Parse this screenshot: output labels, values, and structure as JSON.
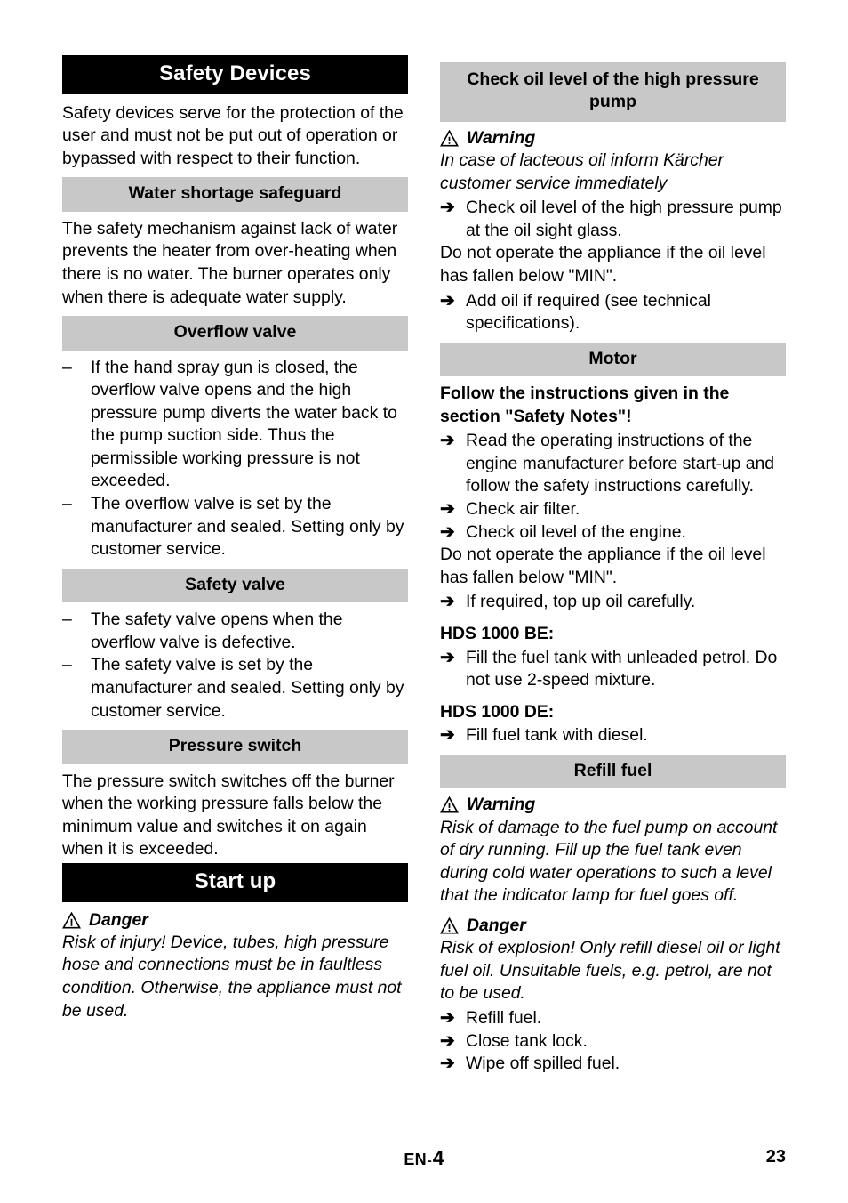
{
  "document": {
    "language_marker": "EN",
    "section_number": "4",
    "page_number": "23",
    "footer_separator": "-"
  },
  "icons": {
    "warning_triangle": "warning-triangle-icon",
    "arrow_bullet": "➔",
    "dash_bullet": "–"
  },
  "colors": {
    "heading_black_bg": "#000000",
    "heading_black_fg": "#ffffff",
    "heading_gray_bg": "#c8c8c8",
    "text": "#000000",
    "page_bg": "#ffffff"
  },
  "left_column": {
    "main_heading": "Safety Devices",
    "intro": "Safety devices serve for the protection of the user and must not be put out of operation or bypassed with respect to their function.",
    "water_shortage": {
      "heading": "Water shortage safeguard",
      "text": "The safety mechanism against lack of water prevents the heater from over-heating when there is no water. The burner operates only when there is adequate water supply."
    },
    "overflow_valve": {
      "heading": "Overflow valve",
      "items": [
        "If the hand spray gun is closed, the overflow valve opens and the high pressure pump diverts the water back to the pump suction side.  Thus the permissible working pressure is not exceeded.",
        "The overflow valve is set by the manufacturer and sealed. Setting only by customer service."
      ]
    },
    "safety_valve": {
      "heading": "Safety valve",
      "items": [
        "The safety valve opens when the overflow valve is defective.",
        "The safety valve is set by the manufacturer and sealed. Setting only by customer service."
      ]
    },
    "pressure_switch": {
      "heading": "Pressure switch",
      "text": "The pressure switch switches off the burner when the working pressure falls below the minimum value and switches it on again when it is exceeded."
    },
    "start_up": {
      "heading": "Start up",
      "danger_label": "Danger",
      "danger_text": "Risk of injury! Device, tubes, high pressure hose and connections must be in faultless condition. Otherwise, the appliance must not be used."
    }
  },
  "right_column": {
    "check_oil": {
      "heading": "Check oil level of the high pressure pump",
      "warning_label": "Warning",
      "warning_text": "In case of lacteous oil inform Kärcher customer service immediately",
      "arrow_items_1": [
        "Check oil level of the high pressure pump at the oil sight glass."
      ],
      "note": "Do not operate the appliance if the oil level has fallen below \"MIN\".",
      "arrow_items_2": [
        "Add oil if required (see technical specifications)."
      ]
    },
    "motor": {
      "heading": "Motor",
      "bold_intro": "Follow the instructions given in the section \"Safety Notes\"!",
      "arrow_items_1": [
        "Read the operating instructions of the engine manufacturer before start-up and follow the safety instructions carefully.",
        "Check air filter.",
        "Check oil level of the engine."
      ],
      "note": "Do not operate the appliance if the oil level has fallen below \"MIN\".",
      "arrow_items_2": [
        "If required, top up oil carefully."
      ],
      "model_be_label": "HDS 1000 BE:",
      "model_be_items": [
        "Fill the fuel tank with unleaded petrol. Do not use 2-speed mixture."
      ],
      "model_de_label": "HDS 1000 DE:",
      "model_de_items": [
        "Fill fuel tank with diesel."
      ]
    },
    "refill_fuel": {
      "heading": "Refill fuel",
      "warning_label": "Warning",
      "warning_text": "Risk of damage to the fuel pump on account of dry running. Fill up the fuel tank even during cold water operations to such a level that the indicator lamp for fuel goes off.",
      "danger_label": "Danger",
      "danger_text": "Risk of explosion! Only refill diesel oil or light fuel oil. Unsuitable fuels, e.g. petrol, are not to be used.",
      "arrow_items": [
        "Refill fuel.",
        "Close tank lock.",
        "Wipe off spilled fuel."
      ]
    }
  }
}
